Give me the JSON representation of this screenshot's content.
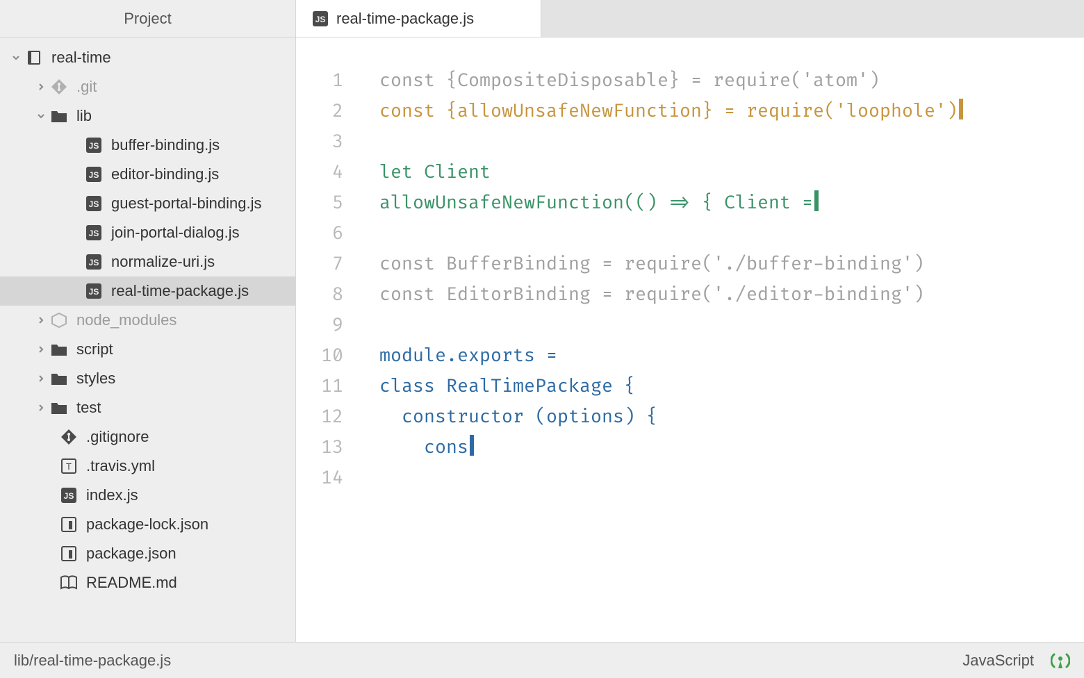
{
  "sidebar": {
    "header": "Project",
    "tree": [
      {
        "indent": 0,
        "chevron": "down",
        "icon": "repo",
        "label": "real-time",
        "muted": false,
        "selected": false,
        "interactable": true
      },
      {
        "indent": 1,
        "chevron": "right",
        "icon": "git",
        "label": ".git",
        "muted": true,
        "selected": false,
        "interactable": true
      },
      {
        "indent": 1,
        "chevron": "down",
        "icon": "folder",
        "label": "lib",
        "muted": false,
        "selected": false,
        "interactable": true
      },
      {
        "indent": 2,
        "chevron": "none",
        "icon": "js",
        "label": "buffer-binding.js",
        "muted": false,
        "selected": false,
        "interactable": true
      },
      {
        "indent": 2,
        "chevron": "none",
        "icon": "js",
        "label": "editor-binding.js",
        "muted": false,
        "selected": false,
        "interactable": true
      },
      {
        "indent": 2,
        "chevron": "none",
        "icon": "js",
        "label": "guest-portal-binding.js",
        "muted": false,
        "selected": false,
        "interactable": true
      },
      {
        "indent": 2,
        "chevron": "none",
        "icon": "js",
        "label": "join-portal-dialog.js",
        "muted": false,
        "selected": false,
        "interactable": true
      },
      {
        "indent": 2,
        "chevron": "none",
        "icon": "js",
        "label": "normalize-uri.js",
        "muted": false,
        "selected": false,
        "interactable": true
      },
      {
        "indent": 2,
        "chevron": "none",
        "icon": "js",
        "label": "real-time-package.js",
        "muted": false,
        "selected": true,
        "interactable": true
      },
      {
        "indent": 1,
        "chevron": "right",
        "icon": "node",
        "label": "node_modules",
        "muted": true,
        "selected": false,
        "interactable": true
      },
      {
        "indent": 1,
        "chevron": "right",
        "icon": "folder",
        "label": "script",
        "muted": false,
        "selected": false,
        "interactable": true
      },
      {
        "indent": 1,
        "chevron": "right",
        "icon": "folder",
        "label": "styles",
        "muted": false,
        "selected": false,
        "interactable": true
      },
      {
        "indent": 1,
        "chevron": "right",
        "icon": "folder",
        "label": "test",
        "muted": false,
        "selected": false,
        "interactable": true
      },
      {
        "indent": 1,
        "chevron": "none",
        "icon": "git",
        "label": ".gitignore",
        "muted": false,
        "selected": false,
        "interactable": true
      },
      {
        "indent": 1,
        "chevron": "none",
        "icon": "travis",
        "label": ".travis.yml",
        "muted": false,
        "selected": false,
        "interactable": true
      },
      {
        "indent": 1,
        "chevron": "none",
        "icon": "js",
        "label": "index.js",
        "muted": false,
        "selected": false,
        "interactable": true
      },
      {
        "indent": 1,
        "chevron": "none",
        "icon": "npm",
        "label": "package-lock.json",
        "muted": false,
        "selected": false,
        "interactable": true
      },
      {
        "indent": 1,
        "chevron": "none",
        "icon": "npm",
        "label": "package.json",
        "muted": false,
        "selected": false,
        "interactable": true
      },
      {
        "indent": 1,
        "chevron": "none",
        "icon": "book",
        "label": "README.md",
        "muted": false,
        "selected": false,
        "interactable": true
      }
    ]
  },
  "tab": {
    "label": "real-time-package.js",
    "icon": "js"
  },
  "editor": {
    "lines": [
      {
        "n": 1,
        "segments": [
          {
            "cls": "grey",
            "text": "const {CompositeDisposable} = require('atom')"
          }
        ]
      },
      {
        "n": 2,
        "segments": [
          {
            "cls": "marked",
            "text": "const {allowUnsafeNewFunction} = require('loophole')"
          }
        ],
        "cursor": "c-orange"
      },
      {
        "n": 3,
        "segments": []
      },
      {
        "n": 4,
        "segments": [
          {
            "cls": "green",
            "text": "let Client"
          }
        ]
      },
      {
        "n": 5,
        "segments": [
          {
            "cls": "green",
            "text": "allowUnsafeNewFunction(() => { Client ="
          }
        ],
        "cursor": "c-green"
      },
      {
        "n": 6,
        "segments": []
      },
      {
        "n": 7,
        "segments": [
          {
            "cls": "grey",
            "text": "const BufferBinding = require('./buffer-binding')"
          }
        ]
      },
      {
        "n": 8,
        "segments": [
          {
            "cls": "grey",
            "text": "const EditorBinding = require('./editor-binding')"
          }
        ]
      },
      {
        "n": 9,
        "segments": []
      },
      {
        "n": 10,
        "segments": [
          {
            "cls": "blue",
            "text": "module.exports ="
          }
        ]
      },
      {
        "n": 11,
        "segments": [
          {
            "cls": "blue",
            "text": "class RealTimePackage {"
          }
        ]
      },
      {
        "n": 12,
        "segments": [
          {
            "cls": "blue",
            "text": "  constructor (options) {"
          }
        ]
      },
      {
        "n": 13,
        "segments": [
          {
            "cls": "blue",
            "text": "    cons"
          }
        ],
        "cursor": "c-blue"
      },
      {
        "n": 14,
        "segments": []
      }
    ]
  },
  "status": {
    "path": "lib/real-time-package.js",
    "language": "JavaScript"
  }
}
